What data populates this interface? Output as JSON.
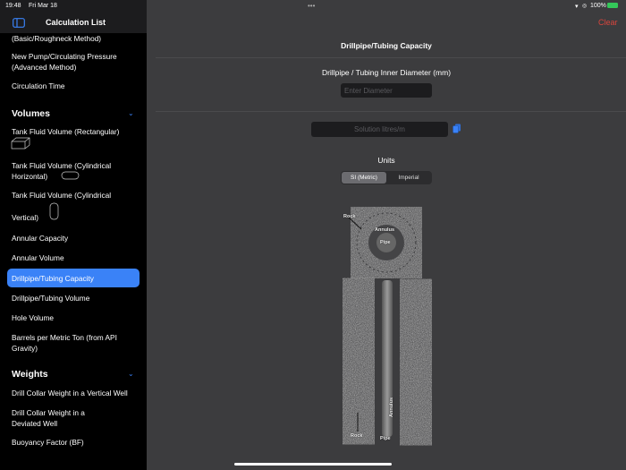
{
  "status": {
    "time": "19:48",
    "date": "Fri Mar 18",
    "battery": "100%",
    "dots": "•••"
  },
  "sidebar": {
    "title": "Calculation List",
    "items": [
      {
        "label": "(Basic/Roughneck Method)"
      },
      {
        "label": "New Pump/Circulating Pressure (Advanced Method)"
      },
      {
        "label": "Circulation Time"
      },
      {
        "label": "Tank Fluid Volume (Rectangular)"
      },
      {
        "label": "Tank Fluid Volume (Cylindrical Horizontal)"
      },
      {
        "label": "Tank Fluid Volume (Cylindrical"
      },
      {
        "label": "Vertical)"
      },
      {
        "label": "Annular Capacity"
      },
      {
        "label": "Annular Volume"
      },
      {
        "label": "Drillpipe/Tubing Capacity"
      },
      {
        "label": "Drillpipe/Tubing Volume"
      },
      {
        "label": "Hole Volume"
      },
      {
        "label": "Barrels per Metric Ton (from API Gravity)"
      },
      {
        "label": "Drill Collar Weight in a Vertical Well"
      },
      {
        "label": "Drill Collar Weight in a Deviated Well"
      },
      {
        "label": "Buoyancy Factor (BF)"
      }
    ],
    "sections": {
      "volumes": "Volumes",
      "weights": "Weights"
    }
  },
  "main": {
    "title": "Drillpipe/Tubing Capacity",
    "clear": "Clear",
    "input_label": "Drillpipe / Tubing Inner Diameter (mm)",
    "input_placeholder": "Enter Diameter",
    "solution_placeholder": "Solution litres/m",
    "units_label": "Units",
    "units": [
      "SI (Metric)",
      "Imperial"
    ],
    "selected_unit": "SI (Metric)",
    "diagram": {
      "rock": "Rock",
      "annulus": "Annulus",
      "pipe": "Pipe"
    }
  },
  "colors": {
    "accent": "#3a82f7",
    "clear": "#d9453d"
  }
}
